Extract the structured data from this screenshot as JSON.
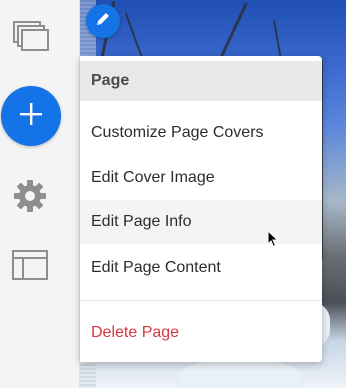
{
  "menu": {
    "header": "Page",
    "items": [
      {
        "label": "Customize Page Covers"
      },
      {
        "label": "Edit Cover Image"
      },
      {
        "label": "Edit Page Info"
      },
      {
        "label": "Edit Page Content"
      }
    ],
    "delete_label": "Delete Page",
    "hovered_item": "Edit Page Info"
  },
  "colors": {
    "accent": "#1473e6",
    "danger": "#d7373f",
    "rail_background": "#f4f4f4",
    "header_background": "#e8e8e8"
  },
  "icons": {
    "pages": "pages-icon",
    "add": "plus-icon",
    "settings": "gear-icon",
    "layout": "layout-icon",
    "edit": "pencil-icon"
  }
}
